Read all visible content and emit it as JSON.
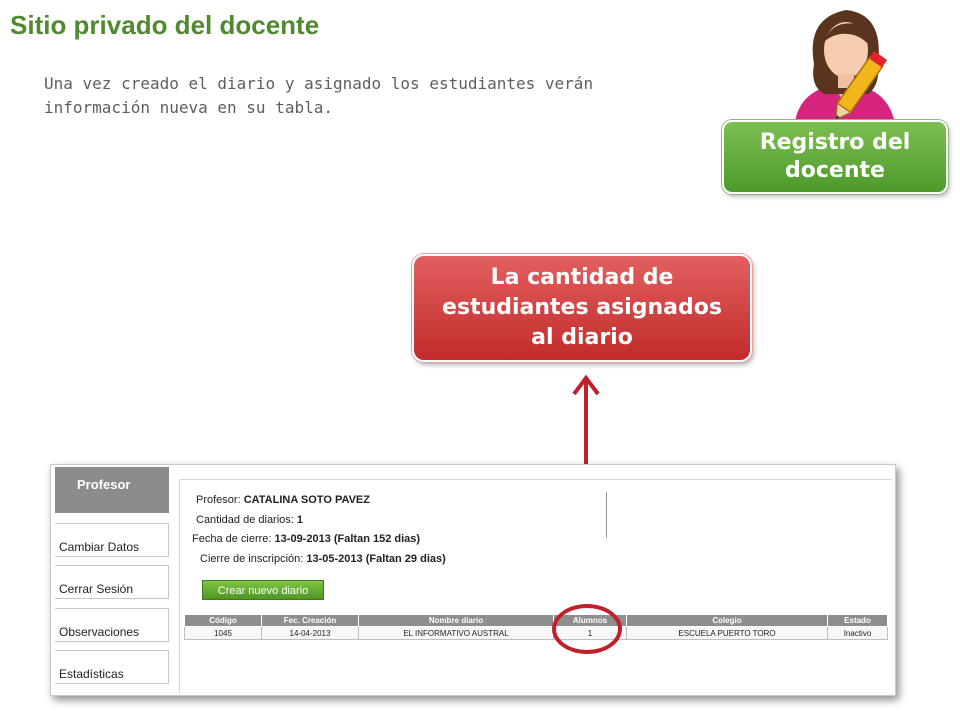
{
  "slide": {
    "title": "Sitio privado del docente",
    "intro": "Una vez creado el diario y asignado los estudiantes verán información nueva en su tabla.",
    "green_button": "Registro del docente",
    "red_callout": "La cantidad de estudiantes asignados al diario"
  },
  "colors": {
    "title": "#4f8a2e",
    "green": "#5aa533",
    "red": "#cf3a3a",
    "circle": "#c0202a"
  },
  "icons": {
    "avatar": "teacher-with-pencil-icon",
    "arrow": "up-arrow-icon"
  },
  "sidebar": {
    "header": "Profesor",
    "items": [
      {
        "label": "Cambiar Datos"
      },
      {
        "label": "Cerrar Sesión"
      },
      {
        "label": "Observaciones"
      },
      {
        "label": "Estadísticas"
      }
    ]
  },
  "info": {
    "profesor_label": "Profesor: ",
    "profesor_value": "CATALINA SOTO PAVEZ",
    "diarios_label": "Cantidad de diarios: ",
    "diarios_value": "1",
    "cierre_label": "Fecha de cierre: ",
    "cierre_value": "13-09-2013 (Faltan 152 dias)",
    "inscripcion_label": "Cierre de inscripción: ",
    "inscripcion_value": "13-05-2013 (Faltan 29 dias)"
  },
  "create_button": "Crear nuevo diario",
  "table": {
    "headers": [
      "Código",
      "Fec. Creación",
      "Nombre diario",
      "Alumnos",
      "Colegio",
      "Estado"
    ],
    "rows": [
      [
        "1045",
        "14-04-2013",
        "EL INFORMATIVO AUSTRAL",
        "1",
        "ESCUELA PUERTO TORO",
        "Inactivo"
      ]
    ]
  }
}
